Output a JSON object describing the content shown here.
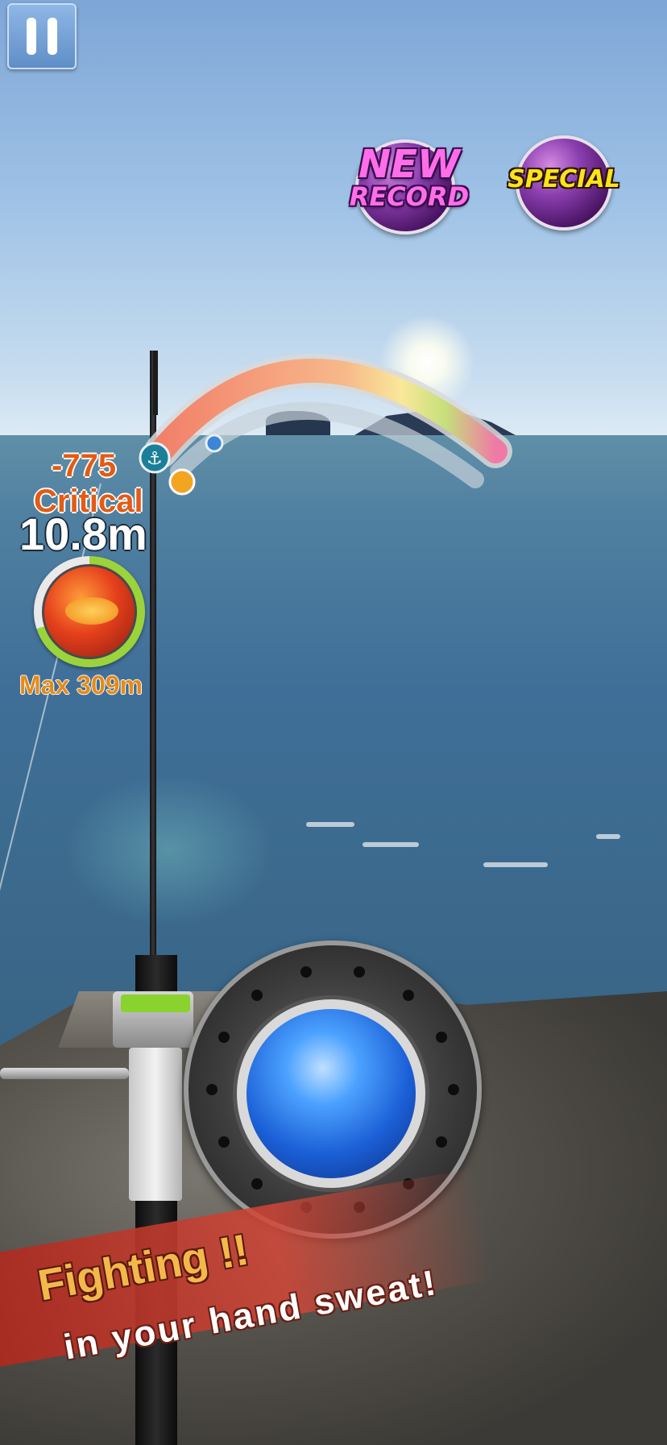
{
  "hud": {
    "pause_icon": "pause-icon",
    "damage": "-775",
    "critical": "Critical",
    "distance": "10.8m",
    "max_distance": "Max 309m",
    "fish_stamina_fraction": 0.7
  },
  "badges": {
    "new_record_line1": "NEW",
    "new_record_line2": "RECORD",
    "special": "SPECIAL"
  },
  "tension_gauge": {
    "hook_icon": "hook-icon",
    "boost_icon": "fire-icon"
  },
  "reel_control": {
    "button_icon": "reel-button"
  },
  "banner": {
    "line1": "Fighting !!",
    "line2": "in your hand sweat!"
  },
  "colors": {
    "sky": "#9fc2e6",
    "sea": "#3f6f98",
    "reel_button": "#1b5fd6",
    "damage_text": "#e35b15",
    "max_text": "#e38b1a",
    "stamina_ring": "#9bd33b"
  }
}
